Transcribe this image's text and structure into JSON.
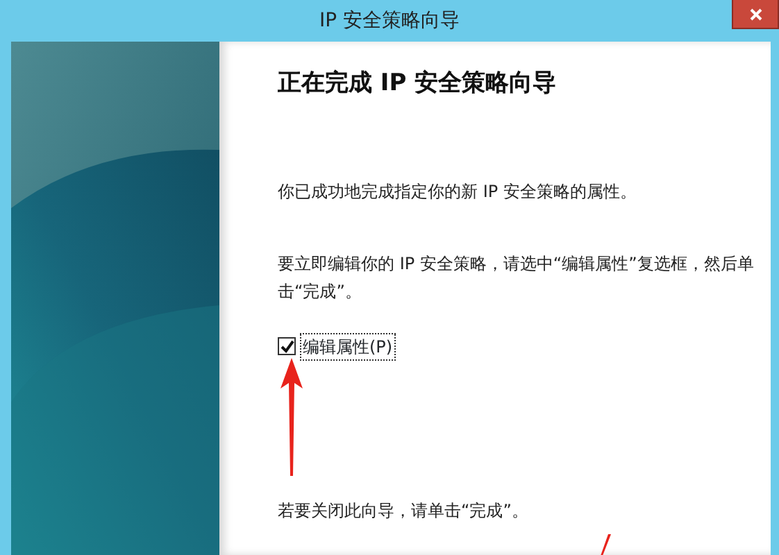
{
  "window": {
    "title": "IP 安全策略向导"
  },
  "heading": "正在完成 IP 安全策略向导",
  "paragraphs": [
    "你已成功地完成指定你的新 IP 安全策略的属性。",
    "要立即编辑你的 IP 安全策略，请选中“编辑属性”复选框，然后单击“完成”。"
  ],
  "checkbox": {
    "label": "编辑属性(P)",
    "checked": true
  },
  "closing_note": "若要关闭此向导，请单击“完成”。"
}
